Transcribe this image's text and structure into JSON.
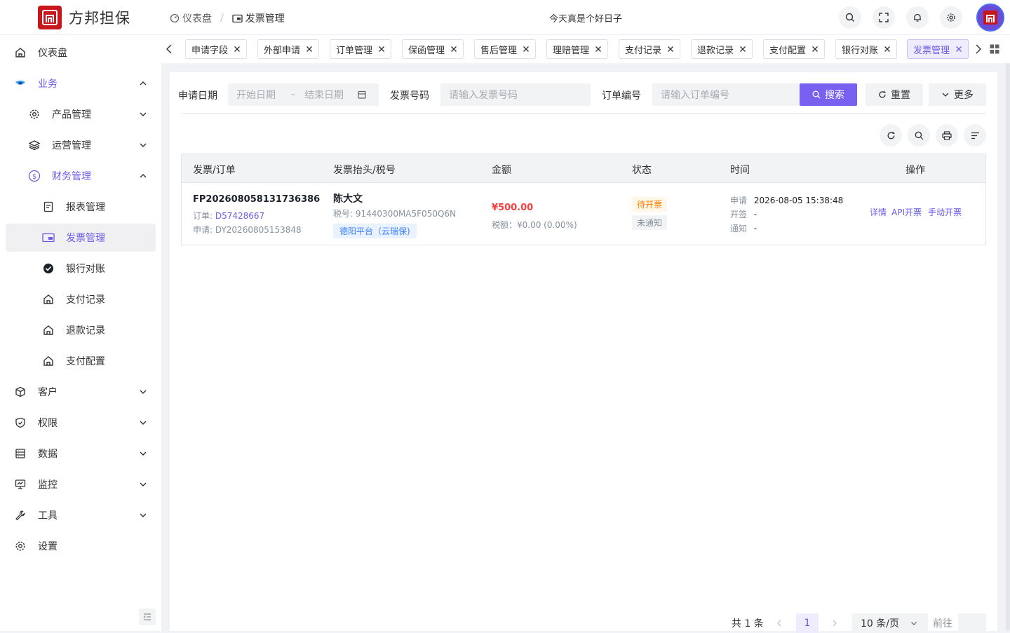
{
  "app": {
    "logo_text": "方邦担保",
    "motto": "今天真是个好日子"
  },
  "breadcrumb": [
    "仪表盘",
    "发票管理"
  ],
  "sidebar": {
    "items": [
      {
        "label": "仪表盘",
        "icon": "home-icon"
      },
      {
        "label": "业务",
        "icon": "business-icon"
      },
      {
        "label": "产品管理",
        "icon": "gear-icon"
      },
      {
        "label": "运营管理",
        "icon": "layers-icon"
      },
      {
        "label": "财务管理",
        "icon": "dollar-icon"
      },
      {
        "label": "报表管理",
        "icon": "document-icon"
      },
      {
        "label": "发票管理",
        "icon": "wallet-icon"
      },
      {
        "label": "银行对账",
        "icon": "check-circle-icon"
      },
      {
        "label": "支付记录",
        "icon": "home-icon"
      },
      {
        "label": "退款记录",
        "icon": "home-icon"
      },
      {
        "label": "支付配置",
        "icon": "home-icon"
      },
      {
        "label": "客户",
        "icon": "box-icon"
      },
      {
        "label": "权限",
        "icon": "shield-icon"
      },
      {
        "label": "数据",
        "icon": "database-icon"
      },
      {
        "label": "监控",
        "icon": "monitor-icon"
      },
      {
        "label": "工具",
        "icon": "wrench-icon"
      },
      {
        "label": "设置",
        "icon": "gear-icon"
      }
    ]
  },
  "tabs": [
    "申请字段",
    "外部申请",
    "订单管理",
    "保函管理",
    "售后管理",
    "理赔管理",
    "支付记录",
    "退款记录",
    "支付配置",
    "银行对账",
    "发票管理"
  ],
  "filter": {
    "date_label": "申请日期",
    "start_placeholder": "开始日期",
    "date_sep": "-",
    "end_placeholder": "结束日期",
    "invoice_label": "发票号码",
    "invoice_placeholder": "请输入发票号码",
    "order_label": "订单编号",
    "order_placeholder": "请输入订单编号",
    "search_btn": "搜索",
    "reset_btn": "重置",
    "more_btn": "更多"
  },
  "table": {
    "headers": [
      "发票/订单",
      "发票抬头/税号",
      "金额",
      "状态",
      "时间",
      "操作"
    ],
    "rows": [
      {
        "invoice_no": "FP202608058131736386",
        "order_label": "订单:",
        "order_no": "D57428667",
        "apply_label": "申请:",
        "apply_no": "DY20260805153848",
        "title": "陈大文",
        "tax_label": "税号:",
        "tax_no": "91440300MA5F050Q6N",
        "platform": "德阳平台（云瑞保)",
        "amount": "¥500.00",
        "tax_amount": "税额：¥0.00 (0.00%)",
        "status1": "待开票",
        "status2": "未通知",
        "time_apply_label": "申请",
        "time_apply": "2026-08-05 15:38:48",
        "time_sign_label": "开签",
        "time_sign": "-",
        "time_notify_label": "通知",
        "time_notify": "-",
        "ops": [
          "详情",
          "API开票",
          "手动开票"
        ]
      }
    ]
  },
  "pagination": {
    "total": "共 1 条",
    "current": "1",
    "page_size": "10 条/页",
    "goto": "前往"
  },
  "colors": {
    "accent": "#7a60f0",
    "brand_red": "#c8161d"
  }
}
